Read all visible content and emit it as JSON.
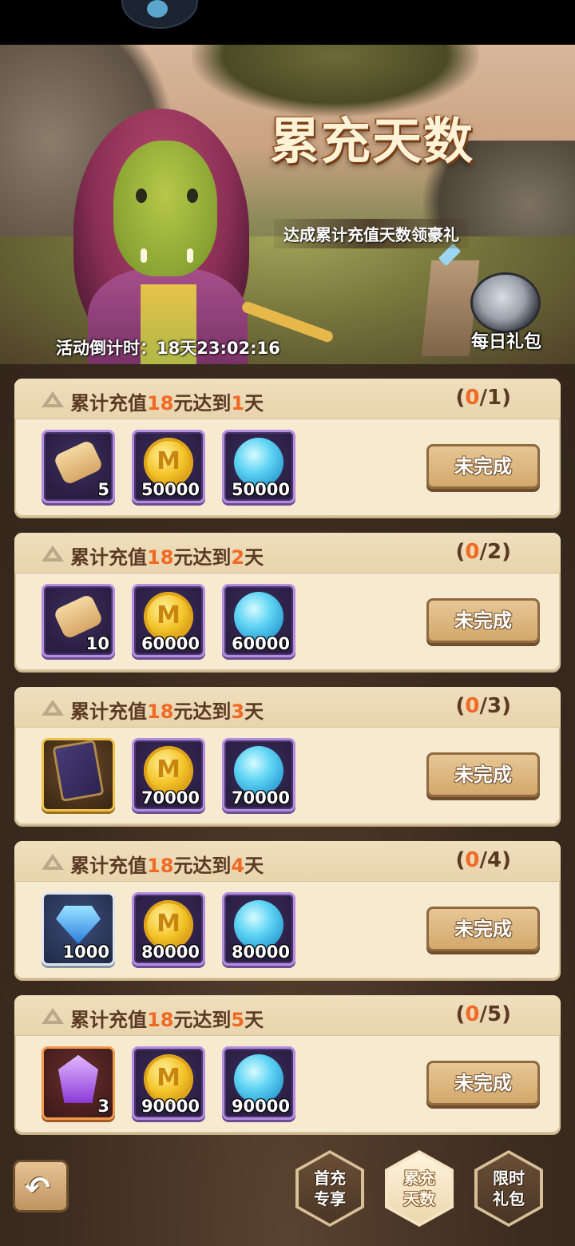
{
  "banner": {
    "title": "累充天数",
    "subtitle": "达成累计充值天数领豪礼",
    "countdown": "活动倒计时：18天23:02:16",
    "daily_gift_label": "每日礼包"
  },
  "tasks": [
    {
      "prefix": "累计充值",
      "amount": "18",
      "mid": "元达到",
      "days": "1",
      "suffix": "天",
      "progress_open": "(",
      "progress_current": "0",
      "progress_total": "/1)",
      "button": "未完成",
      "rewards": [
        {
          "icon": "scroll-icon",
          "qty": "5"
        },
        {
          "icon": "gold-coin-icon",
          "qty": "50000"
        },
        {
          "icon": "blue-orb-icon",
          "qty": "50000"
        }
      ]
    },
    {
      "prefix": "累计充值",
      "amount": "18",
      "mid": "元达到",
      "days": "2",
      "suffix": "天",
      "progress_open": "(",
      "progress_current": "0",
      "progress_total": "/2)",
      "button": "未完成",
      "rewards": [
        {
          "icon": "scroll-icon",
          "qty": "10"
        },
        {
          "icon": "gold-coin-icon",
          "qty": "60000"
        },
        {
          "icon": "blue-orb-icon",
          "qty": "60000"
        }
      ]
    },
    {
      "prefix": "累计充值",
      "amount": "18",
      "mid": "元达到",
      "days": "3",
      "suffix": "天",
      "progress_open": "(",
      "progress_current": "0",
      "progress_total": "/3)",
      "button": "未完成",
      "rewards": [
        {
          "icon": "card-icon",
          "qty": ""
        },
        {
          "icon": "gold-coin-icon",
          "qty": "70000"
        },
        {
          "icon": "blue-orb-icon",
          "qty": "70000"
        }
      ]
    },
    {
      "prefix": "累计充值",
      "amount": "18",
      "mid": "元达到",
      "days": "4",
      "suffix": "天",
      "progress_open": "(",
      "progress_current": "0",
      "progress_total": "/4)",
      "button": "未完成",
      "rewards": [
        {
          "icon": "blue-diamond-icon",
          "qty": "1000"
        },
        {
          "icon": "gold-coin-icon",
          "qty": "80000"
        },
        {
          "icon": "blue-orb-icon",
          "qty": "80000"
        }
      ]
    },
    {
      "prefix": "累计充值",
      "amount": "18",
      "mid": "元达到",
      "days": "5",
      "suffix": "天",
      "progress_open": "(",
      "progress_current": "0",
      "progress_total": "/5)",
      "button": "未完成",
      "rewards": [
        {
          "icon": "purple-gem-icon",
          "qty": "3"
        },
        {
          "icon": "gold-coin-icon",
          "qty": "90000"
        },
        {
          "icon": "blue-orb-icon",
          "qty": "90000"
        }
      ]
    }
  ],
  "nav": {
    "first_recharge": {
      "line1": "首充",
      "line2": "专享"
    },
    "recharge_days": {
      "line1": "累充",
      "line2": "天数"
    },
    "limited_pack": {
      "line1": "限时",
      "line2": "礼包"
    }
  },
  "colors": {
    "highlight": "#f06a25",
    "text_brown": "#5b3a23",
    "panel": "#f6ebd0"
  }
}
